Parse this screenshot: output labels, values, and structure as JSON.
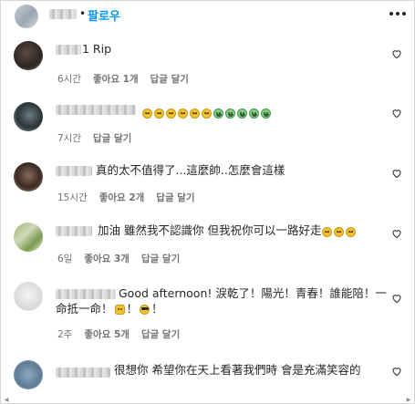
{
  "header": {
    "follow_label": "팔로우",
    "dot": "•",
    "more_icon": "more-horizontal-icon"
  },
  "comments": [
    {
      "text": "1 Rip",
      "time": "6시간",
      "likes": "좋아요 1개",
      "reply": "답글 달기",
      "emojis": []
    },
    {
      "text": "",
      "time": "7시간",
      "likes": "",
      "reply": "답글 달기",
      "emojis": [
        "sad",
        "sad",
        "sad",
        "sad",
        "sad",
        "sad",
        "tear",
        "tear",
        "tear",
        "tear",
        "tear"
      ]
    },
    {
      "text": "真的太不值得了...這麼帥..怎麼會這樣",
      "time": "15시간",
      "likes": "좋아요 2개",
      "reply": "답글 달기",
      "emojis": []
    },
    {
      "text": "加油 雖然我不認識你 但我祝你可以一路好走",
      "time": "6일",
      "likes": "좋아요 3개",
      "reply": "답글 달기",
      "emojis": [
        "sad",
        "sad",
        "sad"
      ]
    },
    {
      "text_line1": "Good afternoon! 淚乾了！陽光！青春！誰能陪！一",
      "text_line2_a": "命抵一命！",
      "text_line2_b": "！",
      "text_line2_c": "！",
      "time": "2주",
      "likes": "좋아요 5개",
      "reply": "답글 달기"
    },
    {
      "text": "很想你 希望你在天上看著我們時 會是充滿笑容的"
    }
  ],
  "colors": {
    "accent": "#0095f6",
    "meta": "#737373",
    "text": "#262626"
  }
}
